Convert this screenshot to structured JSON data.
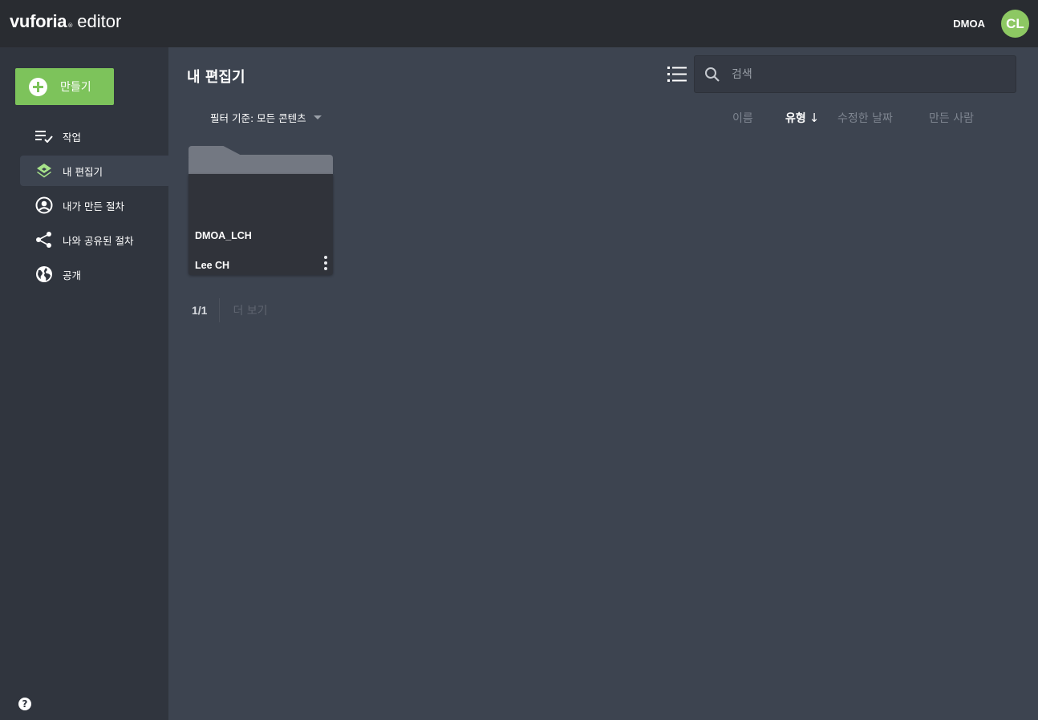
{
  "header": {
    "brand": "vuforia",
    "registered_mark": "®",
    "product": "editor",
    "org_name": "DMOA",
    "avatar_initials": "CL",
    "avatar_color": "#8dc863"
  },
  "sidebar": {
    "create_label": "만들기",
    "accent_color": "#7dc35b",
    "items": [
      {
        "label": "작업",
        "icon": "task-list-icon",
        "active": false
      },
      {
        "label": "내 편집기",
        "icon": "layers-icon",
        "active": true
      },
      {
        "label": "내가 만든 절차",
        "icon": "user-circle-icon",
        "active": false
      },
      {
        "label": "나와 공유된 절차",
        "icon": "share-icon",
        "active": false
      },
      {
        "label": "공개",
        "icon": "globe-icon",
        "active": false
      }
    ],
    "help_label": "?"
  },
  "main": {
    "title": "내 편집기",
    "search_placeholder": "검색",
    "filter_label": "필터 기준: 모든 콘텐츠",
    "sort": {
      "name": "이름",
      "type": "유형",
      "type_arrow": "↓",
      "modified": "수정한 날짜",
      "creator": "만든 사람",
      "active": "type"
    },
    "folders": [
      {
        "name": "DMOA_LCH",
        "owner": "Lee CH"
      }
    ],
    "pager": {
      "count": "1/1",
      "more_label": "더 보기"
    }
  }
}
